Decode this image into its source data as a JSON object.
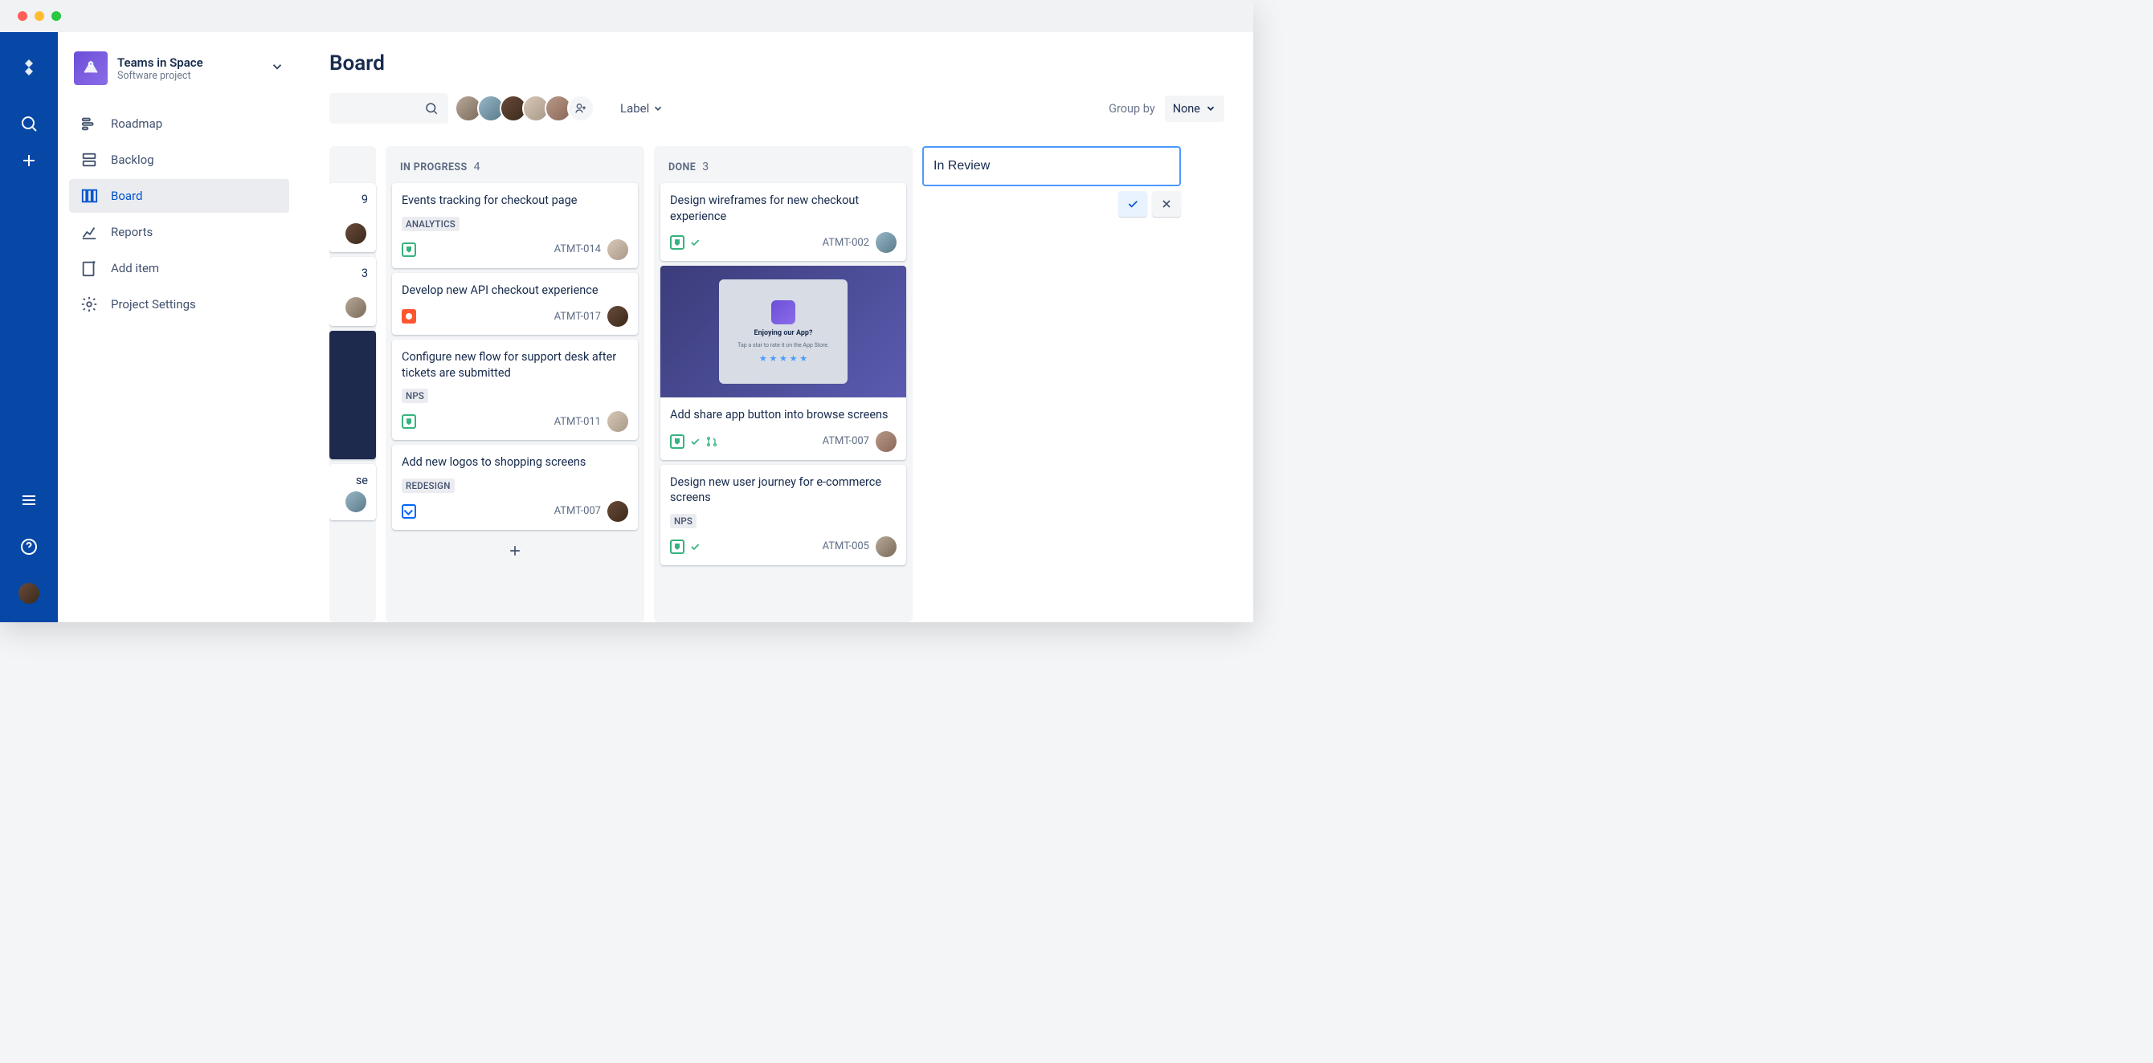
{
  "project": {
    "name": "Teams in Space",
    "type": "Software project"
  },
  "page_title": "Board",
  "sidebar": {
    "items": [
      {
        "label": "Roadmap"
      },
      {
        "label": "Backlog"
      },
      {
        "label": "Board"
      },
      {
        "label": "Reports"
      },
      {
        "label": "Add item"
      },
      {
        "label": "Project Settings"
      }
    ]
  },
  "toolbar": {
    "label_dropdown": "Label",
    "group_by_label": "Group by",
    "group_by_value": "None"
  },
  "columns": {
    "in_progress": {
      "name": "In Progress",
      "count": "4"
    },
    "done": {
      "name": "Done",
      "count": "3"
    }
  },
  "cards": {
    "ip1": {
      "title": "Events tracking for checkout page",
      "tag": "ANALYTICS",
      "id": "ATMT-014"
    },
    "ip2": {
      "title": "Develop new API checkout experience",
      "id": "ATMT-017"
    },
    "ip3": {
      "title": "Configure new flow for support desk after tickets are submitted",
      "tag": "NPS",
      "id": "ATMT-011"
    },
    "ip4": {
      "title": "Add new logos to shopping screens",
      "tag": "REDESIGN",
      "id": "ATMT-007"
    },
    "d1": {
      "title": "Design wireframes for new checkout experience",
      "id": "ATMT-002"
    },
    "d2": {
      "title": "Add share app button into browse screens",
      "id": "ATMT-007",
      "mockup_title": "Enjoying our App?",
      "mockup_sub": "Tap a star to rate it on the App Store."
    },
    "d3": {
      "title": "Design new user journey for e-commerce screens",
      "tag": "NPS",
      "id": "ATMT-005"
    }
  },
  "peek": {
    "num1": "9",
    "num2": "3",
    "text3": "se"
  },
  "new_column": {
    "value": "In Review"
  }
}
